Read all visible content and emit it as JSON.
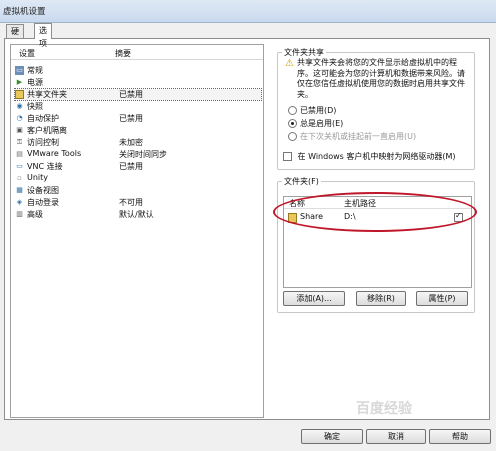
{
  "window_title": "虚拟机设置",
  "tabs": [
    "硬件",
    "选项"
  ],
  "settings_list": {
    "col_setting": "设置",
    "col_summary": "摘要",
    "rows": [
      {
        "name": "常规",
        "summary": "",
        "icon": "general-icon"
      },
      {
        "name": "电源",
        "summary": "",
        "icon": "power-icon"
      },
      {
        "name": "共享文件夹",
        "summary": "已禁用",
        "icon": "shared-folder-icon",
        "selected": true
      },
      {
        "name": "快照",
        "summary": "",
        "icon": "snapshot-icon"
      },
      {
        "name": "自动保护",
        "summary": "已禁用",
        "icon": "autoprotect-icon"
      },
      {
        "name": "客户机隔离",
        "summary": "",
        "icon": "isolation-icon"
      },
      {
        "name": "访问控制",
        "summary": "未加密",
        "icon": "access-control-icon"
      },
      {
        "name": "VMware Tools",
        "summary": "关闭时间同步",
        "icon": "vmware-tools-icon"
      },
      {
        "name": "VNC 连接",
        "summary": "已禁用",
        "icon": "vnc-icon"
      },
      {
        "name": "Unity",
        "summary": "",
        "icon": "unity-icon"
      },
      {
        "name": "设备视图",
        "summary": "",
        "icon": "device-view-icon"
      },
      {
        "name": "自动登录",
        "summary": "不可用",
        "icon": "autologin-icon"
      },
      {
        "name": "高级",
        "summary": "默认/默认",
        "icon": "advanced-icon"
      }
    ]
  },
  "sharing": {
    "group_title": "文件夹共享",
    "warning": "共享文件夹会将您的文件显示给虚拟机中的程序。这可能会为您的计算机和数据带来风险。请仅在您信任虚拟机使用您的数据时启用共享文件夹。",
    "options": [
      {
        "label": "已禁用(D)",
        "checked": false,
        "disabled": false
      },
      {
        "label": "总是启用(E)",
        "checked": true,
        "disabled": false
      },
      {
        "label": "在下次关机或挂起前一直启用(U)",
        "checked": false,
        "disabled": true
      }
    ],
    "map_drive_label": "在 Windows 客户机中映射为网络驱动器(M)",
    "map_drive_checked": false
  },
  "folders": {
    "group_title": "文件夹(F)",
    "col_name": "名称",
    "col_path": "主机路径",
    "items": [
      {
        "name": "Share",
        "path": "D:\\",
        "enabled": true
      }
    ],
    "add_label": "添加(A)...",
    "remove_label": "移除(R)",
    "properties_label": "属性(P)"
  },
  "footer": {
    "ok_label": "确定",
    "cancel_label": "取消",
    "help_label": "帮助"
  },
  "watermark": "百度经验",
  "colors": {
    "highlight_oval": "#c0182a",
    "warning_icon": "#c9a000"
  }
}
